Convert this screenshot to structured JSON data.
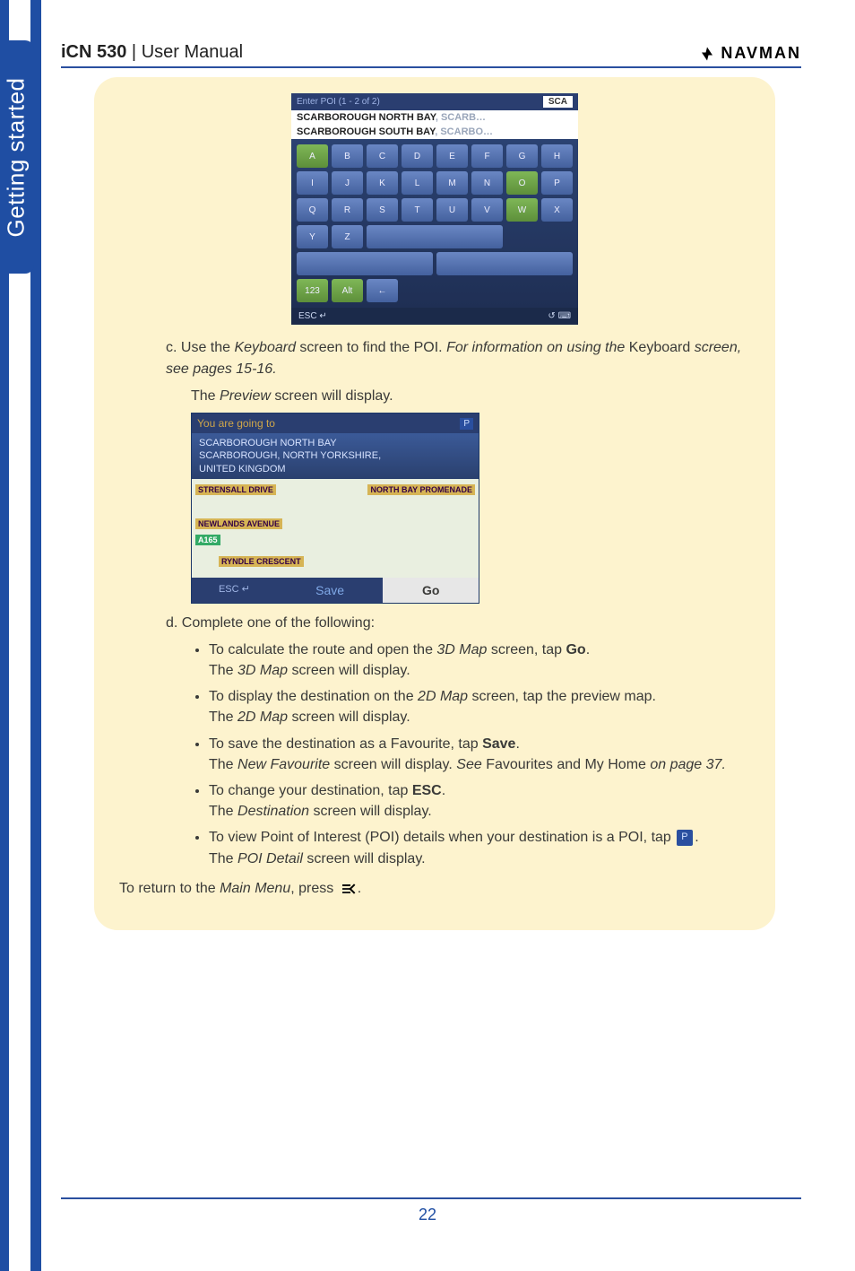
{
  "header": {
    "product": "iCN 530",
    "separator": " | ",
    "subtitle": "User Manual",
    "brand": "NAVMAN"
  },
  "sideTab": {
    "label": "Getting started"
  },
  "keyboardMock": {
    "titleBar": "Enter POI (1 - 2 of 2)",
    "searchValue": "SCA",
    "results": [
      {
        "main": "SCARBOROUGH NORTH BAY",
        "faded": ", SCARB…"
      },
      {
        "main": "SCARBOROUGH SOUTH BAY",
        "faded": ", SCARBO…"
      }
    ],
    "rows": [
      [
        "A",
        "B",
        "C",
        "D",
        "E",
        "F",
        "G",
        "H"
      ],
      [
        "I",
        "J",
        "K",
        "L",
        "M",
        "N",
        "O",
        "P"
      ],
      [
        "Q",
        "R",
        "S",
        "T",
        "U",
        "V",
        "W",
        "X"
      ],
      [
        "Y",
        "Z",
        "",
        "",
        "",
        "123",
        "Alt",
        "←"
      ]
    ],
    "greenCells": [
      "A",
      "O",
      "W",
      "123",
      "Alt"
    ],
    "footerLeft": "ESC ↵"
  },
  "previewMock": {
    "bar": "You are going to",
    "addr1": "SCARBOROUGH NORTH BAY",
    "addr2": "SCARBOROUGH, NORTH YORKSHIRE,",
    "addr3": "UNITED KINGDOM",
    "roads": [
      "STRENSALL DRIVE",
      "NORTH BAY PROMENADE",
      "NEWLANDS AVENUE",
      "A165",
      "RYNDLE CRESCENT"
    ],
    "esc": "ESC ↵",
    "save": "Save",
    "go": "Go"
  },
  "text": {
    "c_lead": "c. Use the ",
    "c_kbd": "Keyboard",
    "c_mid": " screen to find the POI. ",
    "c_info": "For information on using the ",
    "c_kbd2": "Keyboard",
    "c_tail": " screen, see pages 15-16.",
    "c_line2a": "The ",
    "c_preview": "Preview",
    "c_line2b": " screen will display.",
    "d_lead": "d. Complete one of the following:",
    "b1a": "To calculate the route and open the ",
    "b1_3d": "3D Map",
    "b1b": " screen, tap ",
    "b1_go": "Go",
    "b1c": ".",
    "b1_line2a": "The ",
    "b1_line2b": " screen will display.",
    "b2a": "To display the destination on the ",
    "b2_2d": "2D Map",
    "b2b": " screen, tap the preview map.",
    "b2_line2a": "The ",
    "b2_line2b": " screen will display.",
    "b3a": "To save the destination as a Favourite, tap ",
    "b3_save": "Save",
    "b3b": ".",
    "b3_line2a": "The ",
    "b3_newfav": "New Favourite",
    "b3_line2b": " screen will display. ",
    "b3_see": "See ",
    "b3_favs": "Favourites and My Home",
    "b3_onpage": " on page 37.",
    "b4a": "To change your destination, tap ",
    "b4_esc": "ESC",
    "b4b": ".",
    "b4_line2a": "The ",
    "b4_dest": "Destination",
    "b4_line2b": " screen will display.",
    "b5a": "To view Point of Interest (POI) details when your destination is a POI, tap ",
    "b5b": ".",
    "b5_line2a": "The ",
    "b5_poi": "POI Detail",
    "b5_line2b": " screen will display.",
    "return_a": "To return to the ",
    "return_menu": "Main Menu",
    "return_b": ", press ",
    "return_c": "."
  },
  "pageNumber": "22"
}
